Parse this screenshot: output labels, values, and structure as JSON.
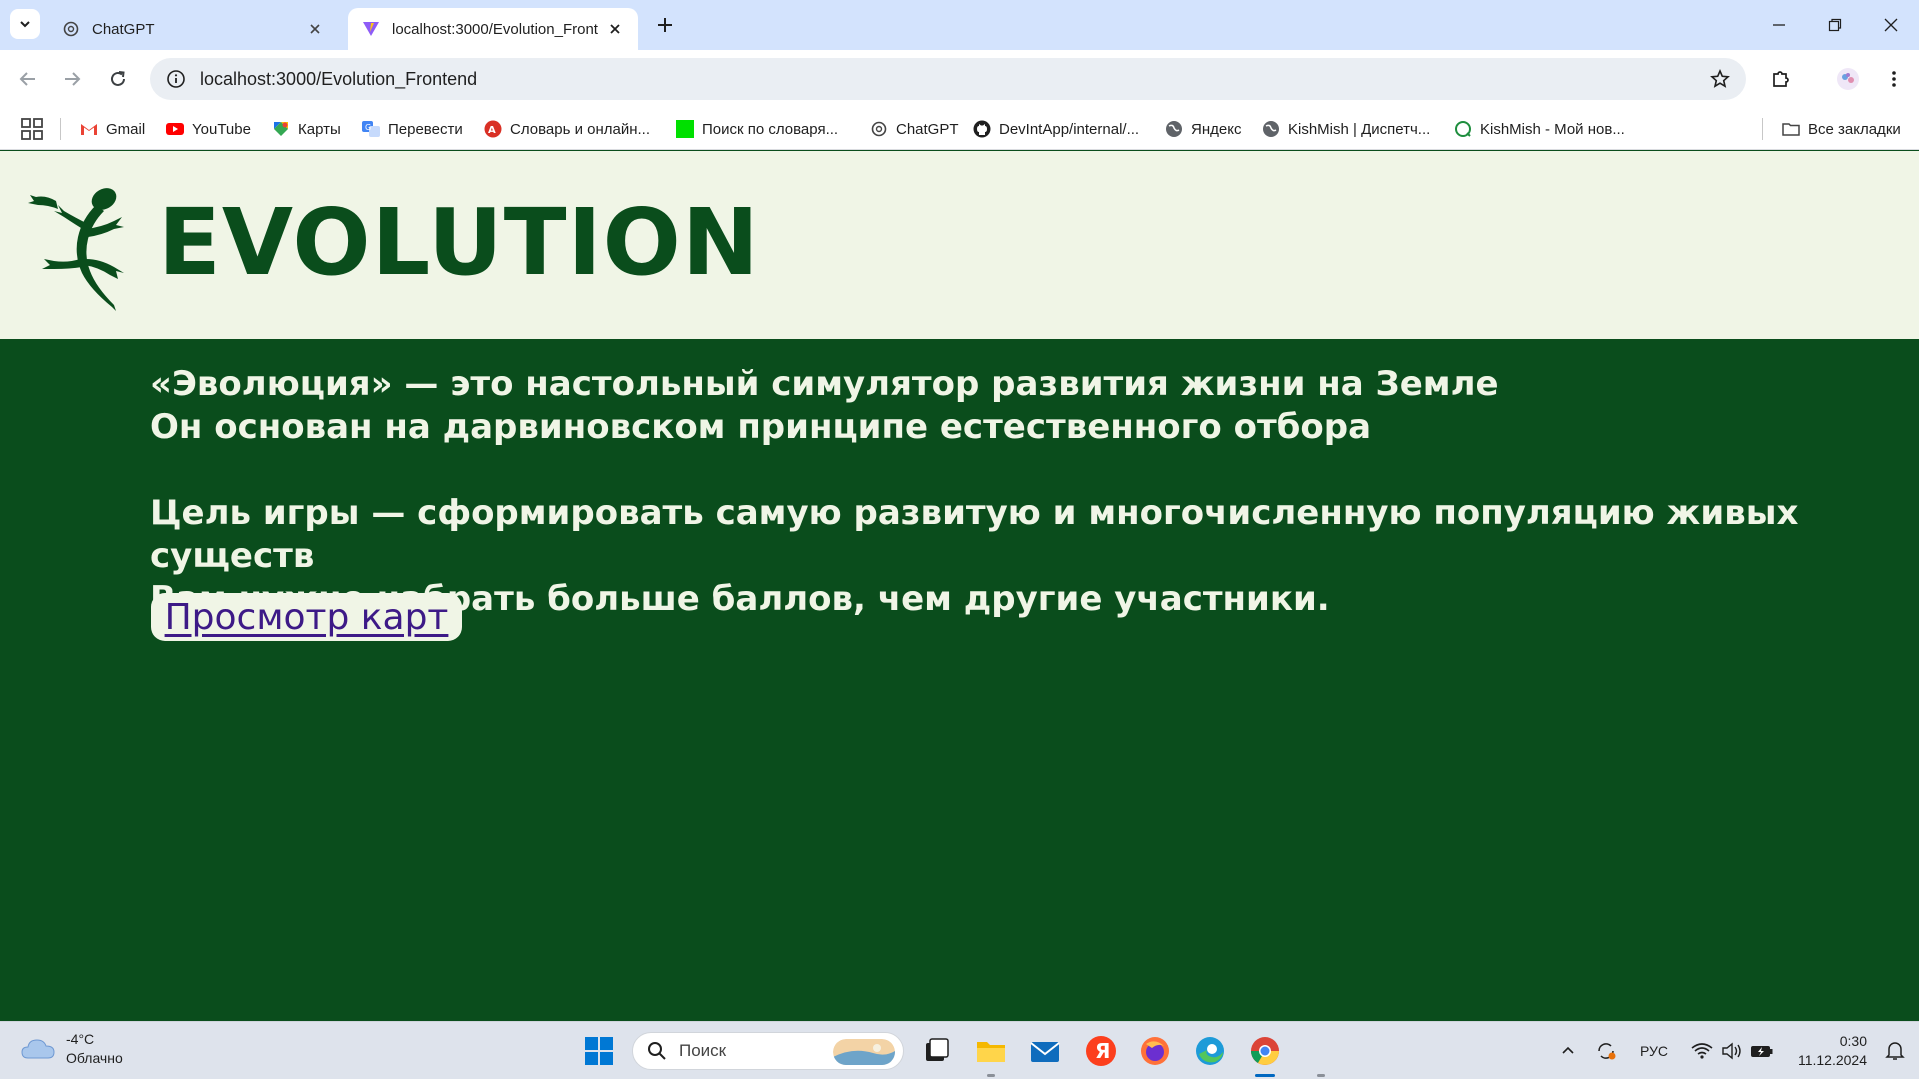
{
  "browser": {
    "tabs": [
      {
        "title": "ChatGPT",
        "active": false,
        "icon": "chatgpt-icon"
      },
      {
        "title": "localhost:3000/Evolution_Frontend",
        "active": true,
        "icon": "vite-icon"
      }
    ],
    "url": "localhost:3000/Evolution_Frontend",
    "bookmarks": [
      {
        "label": "Gmail",
        "icon": "gmail-icon"
      },
      {
        "label": "YouTube",
        "icon": "youtube-icon"
      },
      {
        "label": "Карты",
        "icon": "maps-icon"
      },
      {
        "label": "Перевести",
        "icon": "translate-icon"
      },
      {
        "label": "Словарь и онлайн...",
        "icon": "dictionary-icon"
      },
      {
        "label": "Поиск по словаря...",
        "icon": "green-square-icon"
      },
      {
        "label": "ChatGPT",
        "icon": "chatgpt-icon"
      },
      {
        "label": "DevIntApp/internal/...",
        "icon": "github-icon"
      },
      {
        "label": "Яндекс",
        "icon": "globe-icon"
      },
      {
        "label": "KishMish | Диспетч...",
        "icon": "globe-icon"
      },
      {
        "label": "KishMish - Мой нов...",
        "icon": "kishmish-icon"
      }
    ],
    "all_bookmarks": "Все закладки"
  },
  "page": {
    "brand": "EVOLUTION",
    "intro": {
      "line1": "«Эволюция» — это настольный симулятор развития жизни на Земле",
      "line2": "Он основан на дарвиновском принципе естественного отбора",
      "line3": "Цель игры — сформировать самую развитую и многочисленную популяцию живых существ",
      "line4": "Вам нужно набрать больше баллов, чем другие участники."
    },
    "cards_button": "Просмотр карт",
    "colors": {
      "dark_green": "#0a4d1c",
      "cream": "#f0f5e6",
      "link": "#3d1a87"
    }
  },
  "taskbar": {
    "weather": {
      "temp": "-4°C",
      "condition": "Облачно"
    },
    "search_placeholder": "Поиск",
    "tray": {
      "language": "РУС"
    },
    "clock": {
      "time": "0:30",
      "date": "11.12.2024"
    }
  }
}
